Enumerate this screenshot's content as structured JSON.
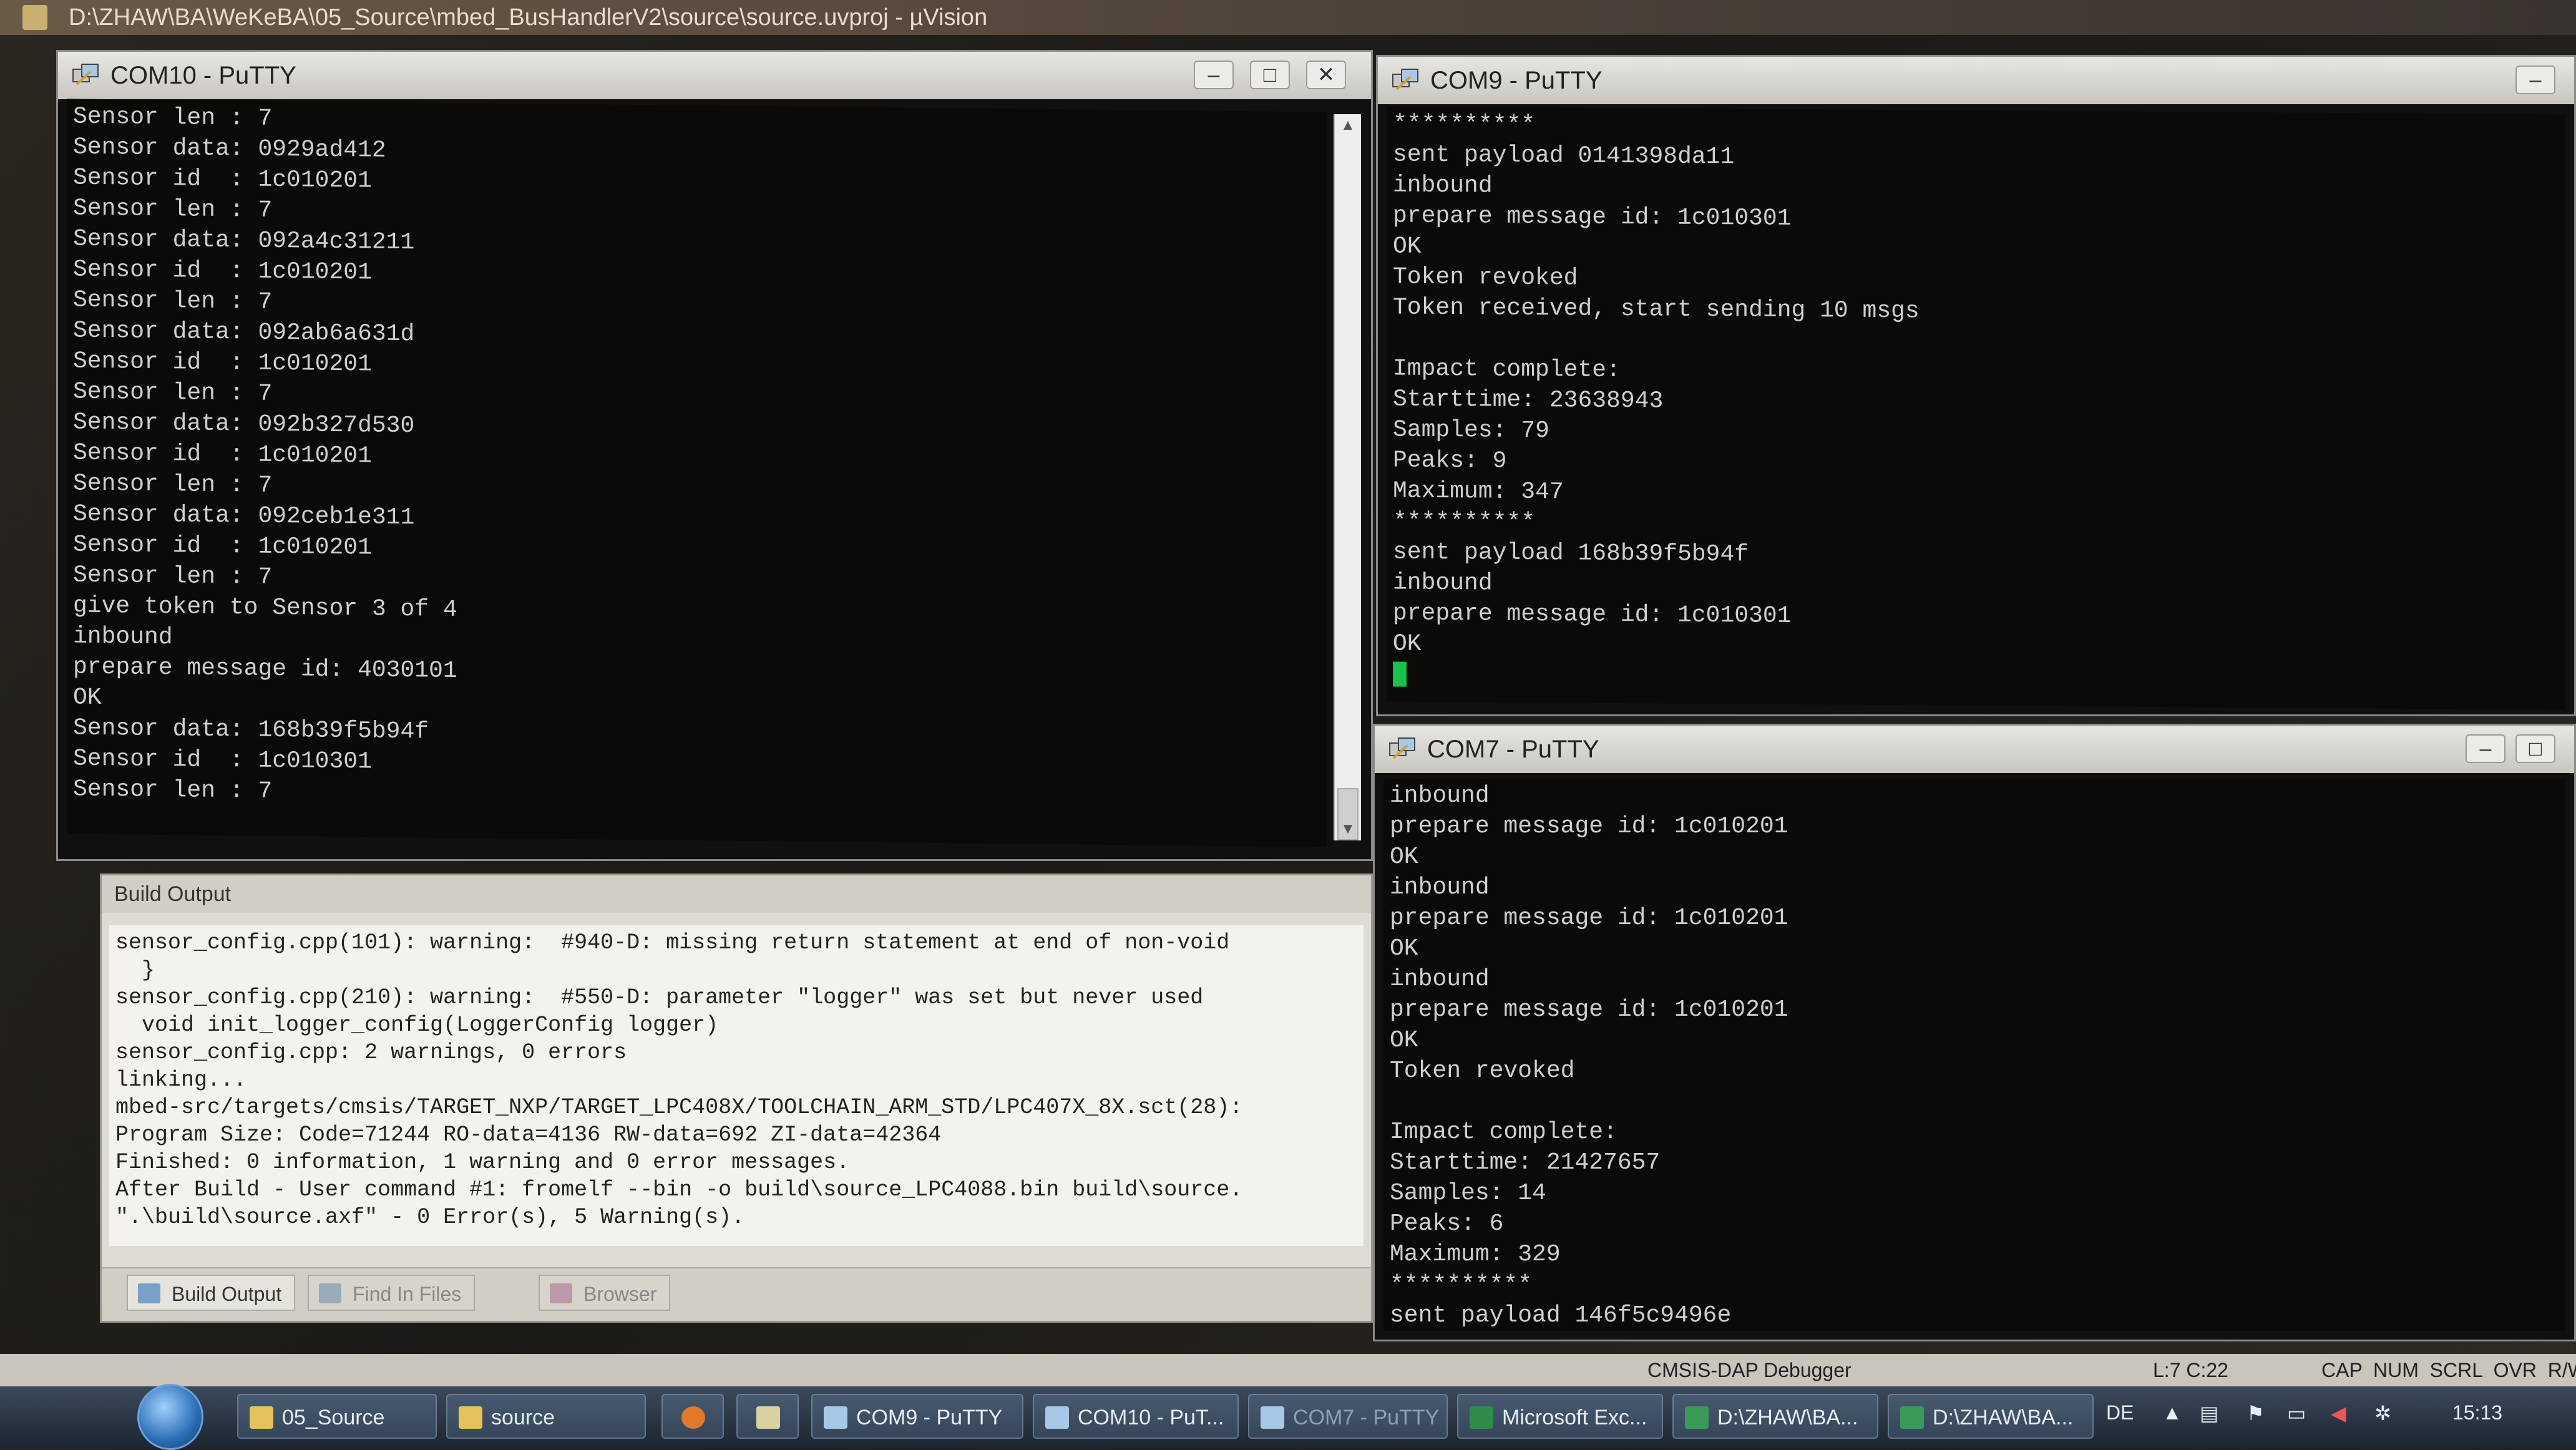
{
  "main_window": {
    "title": "D:\\ZHAW\\BA\\WeKeBA\\05_Source\\mbed_BusHandlerV2\\source\\source.uvproj - µVision"
  },
  "com10": {
    "title": "COM10 - PuTTY",
    "lines": [
      "Sensor len : 7",
      "Sensor data: 0929ad412",
      "Sensor id  : 1c010201",
      "Sensor len : 7",
      "Sensor data: 092a4c31211",
      "Sensor id  : 1c010201",
      "Sensor len : 7",
      "Sensor data: 092ab6a631d",
      "Sensor id  : 1c010201",
      "Sensor len : 7",
      "Sensor data: 092b327d530",
      "Sensor id  : 1c010201",
      "Sensor len : 7",
      "Sensor data: 092ceb1e311",
      "Sensor id  : 1c010201",
      "Sensor len : 7",
      "give token to Sensor 3 of 4",
      "inbound",
      "prepare message id: 4030101",
      "OK",
      "Sensor data: 168b39f5b94f",
      "Sensor id  : 1c010301",
      "Sensor len : 7"
    ]
  },
  "com9": {
    "title": "COM9 - PuTTY",
    "lines": [
      "**********",
      "sent payload 0141398da11",
      "inbound",
      "prepare message id: 1c010301",
      "OK",
      "Token revoked",
      "Token received, start sending 10 msgs",
      "",
      "Impact complete:",
      "Starttime: 23638943",
      "Samples: 79",
      "Peaks: 9",
      "Maximum: 347",
      "**********",
      "sent payload 168b39f5b94f",
      "inbound",
      "prepare message id: 1c010301",
      "OK"
    ]
  },
  "com7": {
    "title": "COM7 - PuTTY",
    "lines": [
      "inbound",
      "prepare message id: 1c010201",
      "OK",
      "inbound",
      "prepare message id: 1c010201",
      "OK",
      "inbound",
      "prepare message id: 1c010201",
      "OK",
      "Token revoked",
      "",
      "Impact complete:",
      "Starttime: 21427657",
      "Samples: 14",
      "Peaks: 6",
      "Maximum: 329",
      "**********",
      "sent payload 146f5c9496e"
    ]
  },
  "build_output": {
    "header": "Build Output",
    "lines": [
      "sensor_config.cpp(101): warning:  #940-D: missing return statement at end of non-void",
      "  }",
      "sensor_config.cpp(210): warning:  #550-D: parameter \"logger\" was set but never used",
      "  void init_logger_config(LoggerConfig logger)",
      "sensor_config.cpp: 2 warnings, 0 errors",
      "linking...",
      "mbed-src/targets/cmsis/TARGET_NXP/TARGET_LPC408X/TOOLCHAIN_ARM_STD/LPC407X_8X.sct(28):",
      "Program Size: Code=71244 RO-data=4136 RW-data=692 ZI-data=42364",
      "Finished: 0 information, 1 warning and 0 error messages.",
      "After Build - User command #1: fromelf --bin -o build\\source_LPC4088.bin build\\source.",
      "\".\\build\\source.axf\" - 0 Error(s), 5 Warning(s)."
    ],
    "tabs": [
      "Build Output",
      "Find In Files",
      "Browser"
    ]
  },
  "statusbar": {
    "debugger": "CMSIS-DAP Debugger",
    "position": "L:7 C:22",
    "indicators": "CAP  NUM  SCRL  OVR  R/W"
  },
  "taskbar": {
    "items": [
      "05_Source",
      "source",
      "COM9 - PuTTY",
      "COM10 - PuT...",
      "COM7 - PuTTY",
      "Microsoft Exc...",
      "D:\\ZHAW\\BA...",
      "D:\\ZHAW\\BA..."
    ],
    "language": "DE",
    "clock": "15:13"
  }
}
